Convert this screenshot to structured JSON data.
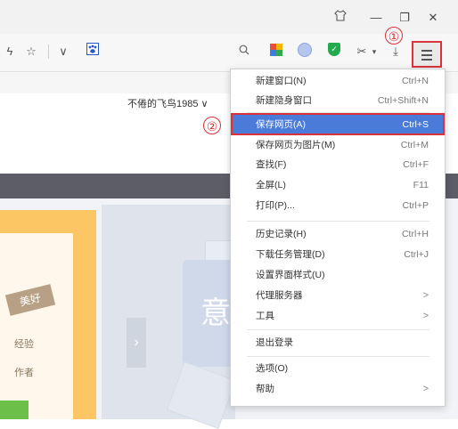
{
  "titlebar": {
    "shirt_icon": "shirt-icon",
    "minimize": "—",
    "restore": "❐",
    "close": "✕"
  },
  "toolbar": {
    "zap": "ϟ",
    "star": "☆",
    "chevron": "∨",
    "search": "⚲",
    "scissors": "✂",
    "download": "⤓",
    "caret": "▾"
  },
  "markers": {
    "first": "①",
    "second": "②"
  },
  "page": {
    "username": "不倦的飞鸟1985 ∨",
    "ribbon_text": "美好",
    "line1": "经验",
    "line2": "作者",
    "arrow": "›",
    "deco_char": "意"
  },
  "menu": {
    "items": [
      {
        "label": "新建窗口(N)",
        "shortcut": "Ctrl+N"
      },
      {
        "label": "新建隐身窗口",
        "shortcut": "Ctrl+Shift+N"
      },
      {
        "label": "保存网页(A)",
        "shortcut": "Ctrl+S"
      },
      {
        "label": "保存网页为图片(M)",
        "shortcut": "Ctrl+M"
      },
      {
        "label": "查找(F)",
        "shortcut": "Ctrl+F"
      },
      {
        "label": "全屏(L)",
        "shortcut": "F11"
      },
      {
        "label": "打印(P)...",
        "shortcut": "Ctrl+P"
      },
      {
        "label": "历史记录(H)",
        "shortcut": "Ctrl+H"
      },
      {
        "label": "下载任务管理(D)",
        "shortcut": "Ctrl+J"
      },
      {
        "label": "设置界面样式(U)",
        "shortcut": ""
      },
      {
        "label": "代理服务器",
        "shortcut": ""
      },
      {
        "label": "工具",
        "shortcut": ""
      },
      {
        "label": "退出登录",
        "shortcut": ""
      },
      {
        "label": "选项(O)",
        "shortcut": ""
      },
      {
        "label": "帮助",
        "shortcut": ""
      }
    ],
    "submenu_chevron": ">",
    "highlight_color": "#4a7bd8"
  },
  "colors": {
    "marker_red": "#d9323a",
    "accent_orange": "#fbc663"
  }
}
